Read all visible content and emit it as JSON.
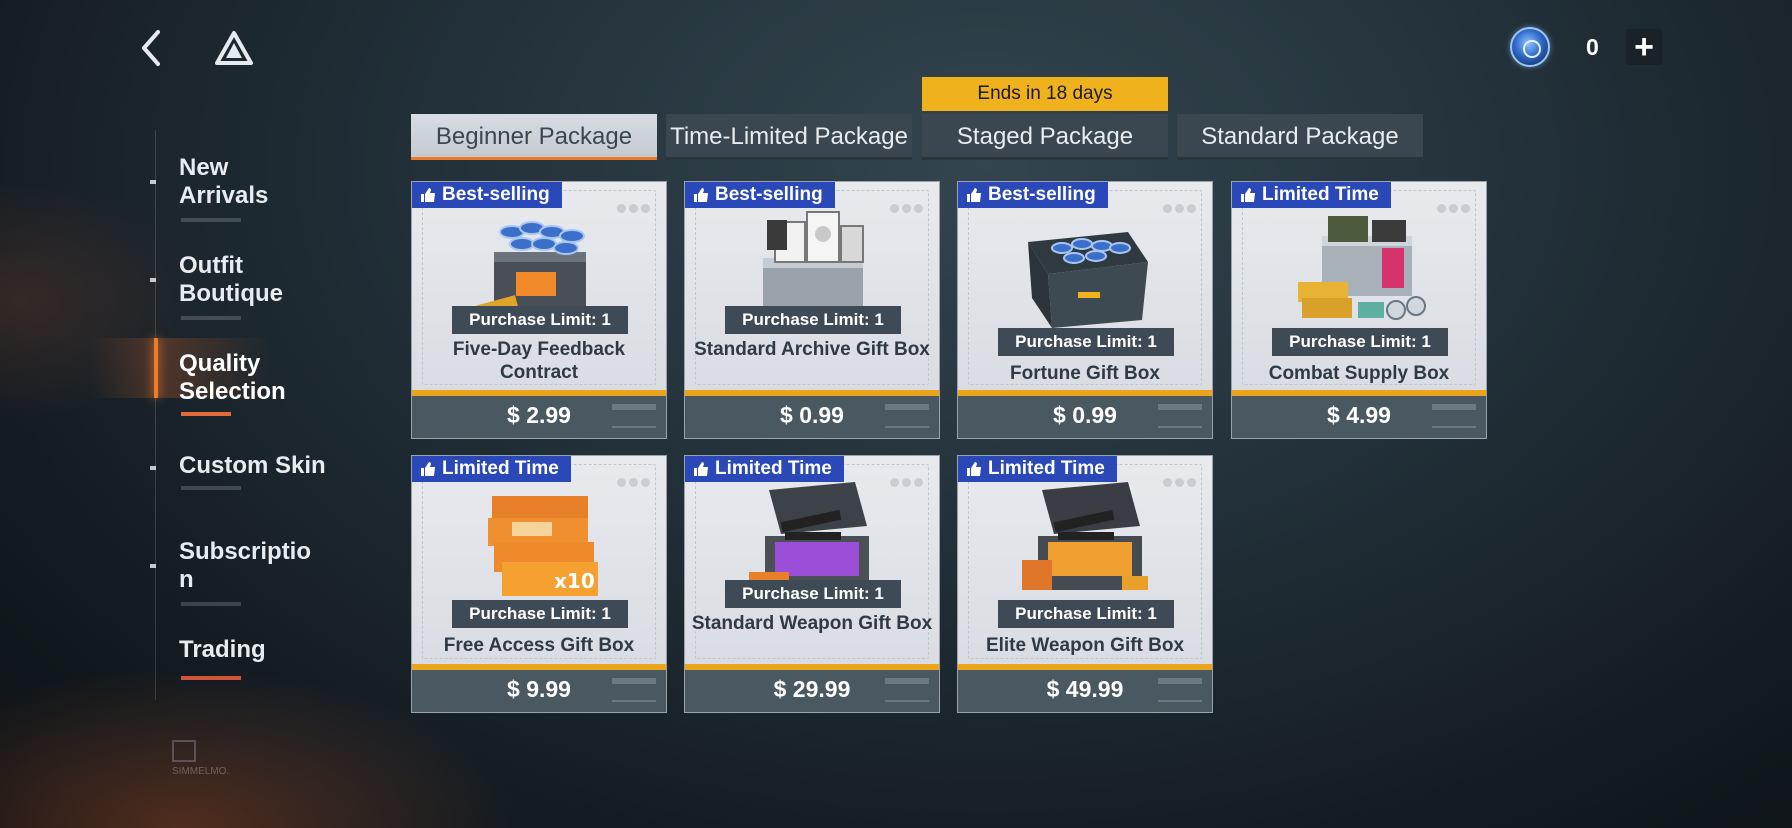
{
  "header": {
    "currency_amount": "0",
    "back_icon": "chevron-left-icon",
    "home_icon": "triangle-logo-icon",
    "add_icon": "plus-icon"
  },
  "sidebar": {
    "items": [
      {
        "label": "New\nArrivals"
      },
      {
        "label": "Outfit\nBoutique"
      },
      {
        "label": "Quality\nSelection"
      },
      {
        "label": "Custom Skin"
      },
      {
        "label": "Subscriptio\nn"
      },
      {
        "label": "Trading"
      }
    ],
    "active_index": 2
  },
  "tabs": {
    "ends_banner": "Ends in 18 days",
    "items": [
      {
        "label": "Beginner Package"
      },
      {
        "label": "Time-Limited Package"
      },
      {
        "label": "Staged Package"
      },
      {
        "label": "Standard Package"
      }
    ],
    "active_index": 0
  },
  "products": [
    {
      "badge": "Best-selling",
      "limit": "Purchase Limit: 1",
      "name": "Five-Day Feedback Contract",
      "price": "$ 2.99"
    },
    {
      "badge": "Best-selling",
      "limit": "Purchase Limit: 1",
      "name": "Standard Archive Gift Box",
      "price": "$ 0.99"
    },
    {
      "badge": "Best-selling",
      "limit": "Purchase Limit: 1",
      "name": "Fortune Gift Box",
      "price": "$ 0.99"
    },
    {
      "badge": "Limited Time",
      "limit": "Purchase Limit: 1",
      "name": "Combat Supply Box",
      "price": "$ 4.99"
    },
    {
      "badge": "Limited Time",
      "limit": "Purchase Limit: 1",
      "name": "Free Access Gift Box",
      "price": "$ 9.99"
    },
    {
      "badge": "Limited Time",
      "limit": "Purchase Limit: 1",
      "name": "Standard Weapon Gift Box",
      "price": "$ 29.99"
    },
    {
      "badge": "Limited Time",
      "limit": "Purchase Limit: 1",
      "name": "Elite Weapon Gift Box",
      "price": "$ 49.99"
    }
  ],
  "colors": {
    "accent_orange": "#f07a2c",
    "banner_yellow": "#f0b21c",
    "badge_blue": "#2a48b8",
    "price_stripe": "#eaa51c"
  }
}
